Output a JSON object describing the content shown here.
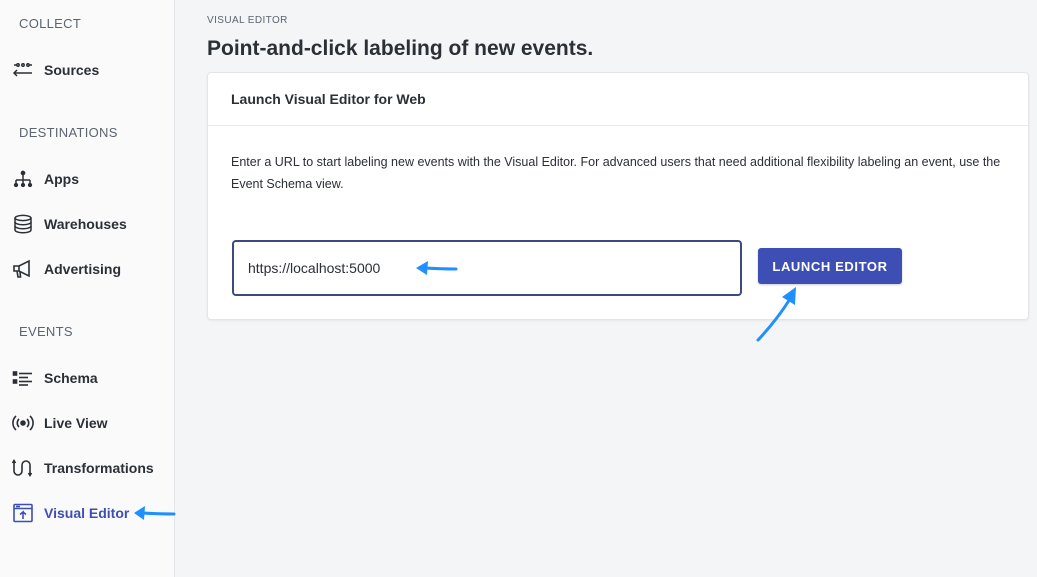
{
  "sidebar": {
    "sections": [
      {
        "title": "COLLECT",
        "items": [
          {
            "label": "Sources",
            "icon": "sources-icon"
          }
        ]
      },
      {
        "title": "DESTINATIONS",
        "items": [
          {
            "label": "Apps",
            "icon": "apps-icon"
          },
          {
            "label": "Warehouses",
            "icon": "database-icon"
          },
          {
            "label": "Advertising",
            "icon": "megaphone-icon"
          }
        ]
      },
      {
        "title": "EVENTS",
        "items": [
          {
            "label": "Schema",
            "icon": "schema-list-icon"
          },
          {
            "label": "Live View",
            "icon": "broadcast-icon"
          },
          {
            "label": "Transformations",
            "icon": "transform-icon"
          },
          {
            "label": "Visual Editor",
            "icon": "visual-editor-icon",
            "active": true
          }
        ]
      }
    ]
  },
  "main": {
    "eyebrow": "VISUAL EDITOR",
    "title": "Point-and-click labeling of new events.",
    "card": {
      "title": "Launch Visual Editor for Web",
      "description": "Enter a URL to start labeling new events with the Visual Editor. For advanced users that need additional flexibility labeling an event, use the Event Schema view.",
      "url_value": "https://localhost:5000",
      "launch_label": "LAUNCH EDITOR"
    }
  },
  "colors": {
    "accent": "#3d4fb4",
    "annotation_arrow": "#1e90ff"
  }
}
